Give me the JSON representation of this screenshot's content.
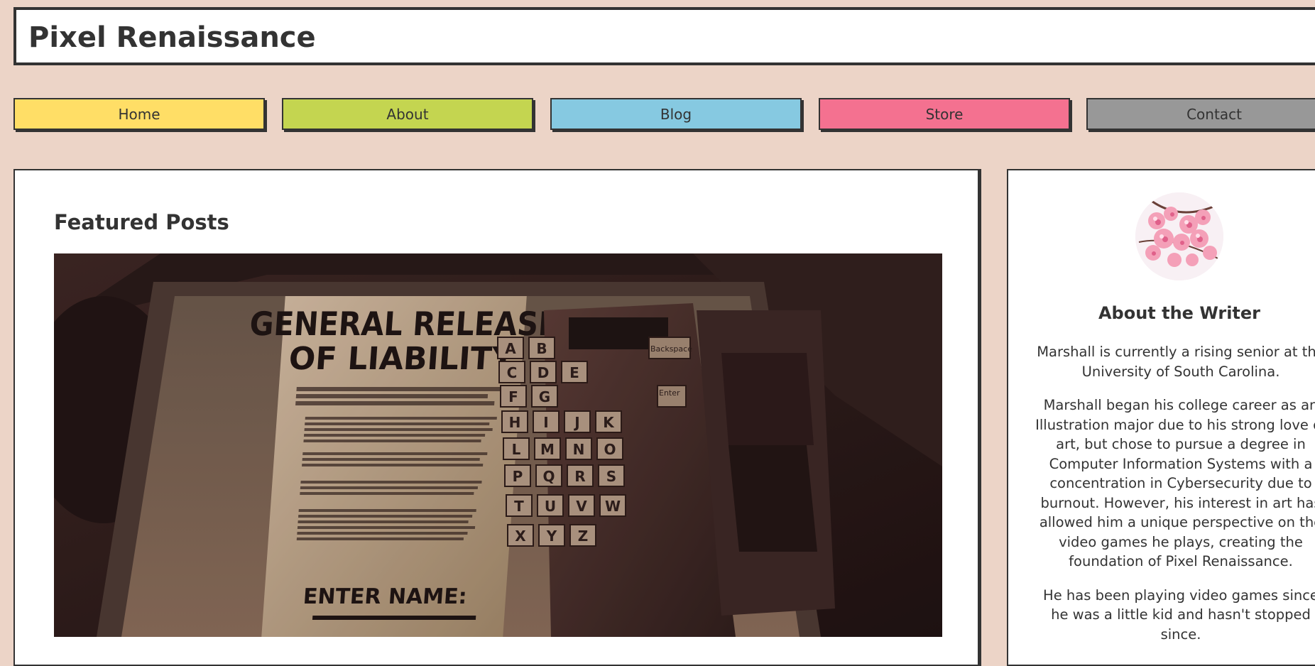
{
  "site": {
    "title": "Pixel Renaissance"
  },
  "nav": {
    "home": "Home",
    "about": "About",
    "blog": "Blog",
    "store": "Store",
    "contact": "Contact"
  },
  "main": {
    "heading": "Featured Posts",
    "featured_image": {
      "headline_line1": "GENERAL RELEASE",
      "headline_line2": "OF LIABILITY",
      "footer_text": "ENTER NAME:",
      "keys": [
        "A",
        "B",
        "C",
        "D",
        "E",
        "F",
        "G",
        "H",
        "I",
        "J",
        "K",
        "L",
        "M",
        "N",
        "O",
        "P",
        "Q",
        "R",
        "S",
        "T",
        "U",
        "V",
        "W",
        "X",
        "Y",
        "Z"
      ],
      "backspace_label": "Backspace",
      "enter_label": "Enter"
    }
  },
  "sidebar": {
    "heading": "About the Writer",
    "avatar_icon": "cherry-blossom-image",
    "paragraphs": [
      "Marshall is currently a rising senior at the University of South Carolina.",
      "Marshall began his college career as an Illustration major due to his strong love of art, but chose to pursue a degree in Computer Information Systems with a concentration in Cybersecurity due to burnout. However, his interest in art has allowed him a unique perspective on the video games he plays, creating the foundation of Pixel Renaissance.",
      "He has been playing video games since he was a little kid and hasn't stopped since."
    ]
  },
  "colors": {
    "background": "#ecd4c7",
    "home": "#ffde66",
    "about": "#c4d550",
    "blog": "#86c9e1",
    "store": "#f47190",
    "contact": "#989898",
    "text": "#333333"
  }
}
